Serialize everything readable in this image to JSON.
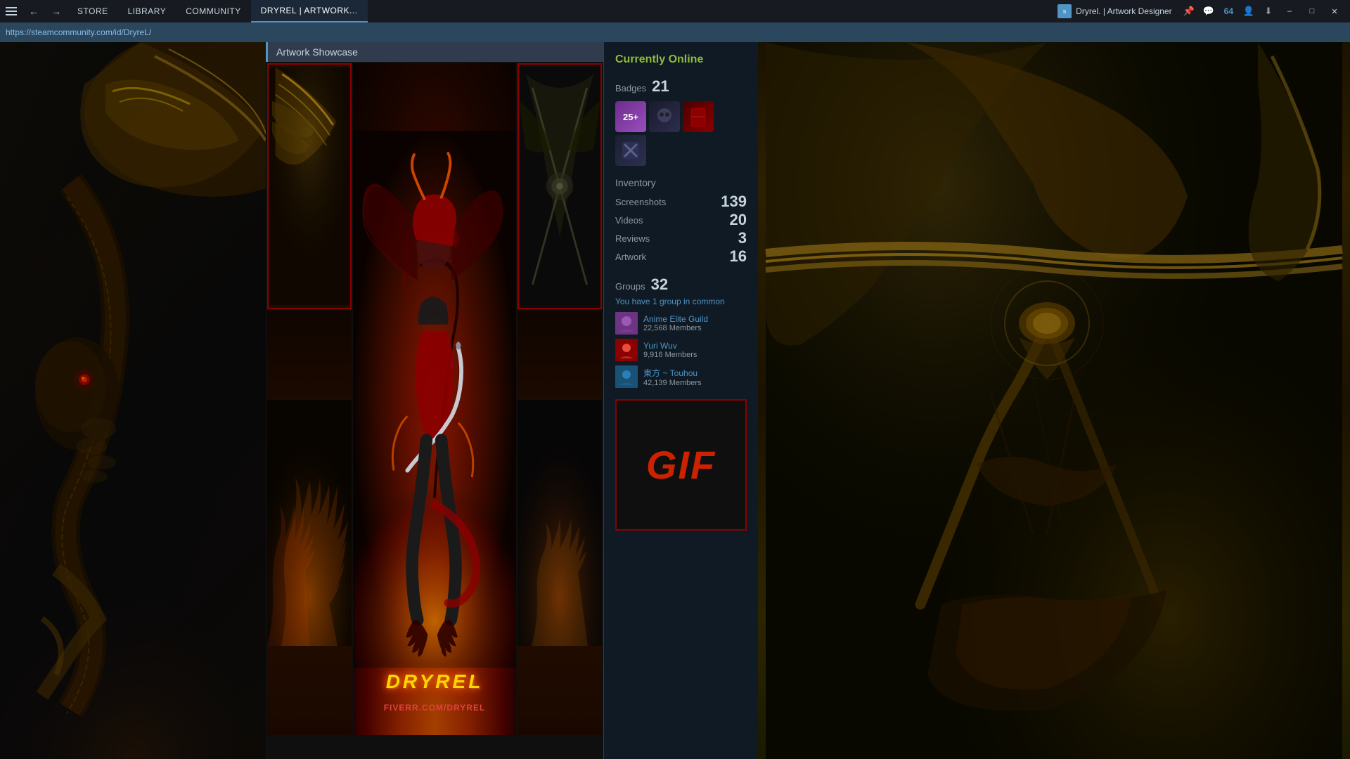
{
  "titlebar": {
    "nav_items": [
      "STORE",
      "LIBRARY",
      "COMMUNITY"
    ],
    "active_tab": "DRYREL | ARTWORK...",
    "app_title": "Dryrel. | Artwork Designer",
    "badge_count": "64",
    "address": "https://steamcommunity.com/id/DryreL/"
  },
  "profile": {
    "online_status": "Currently Online",
    "badges": {
      "label": "Badges",
      "count": "21",
      "items": [
        {
          "label": "25+",
          "type": "years"
        },
        {
          "label": "skull",
          "type": "icon"
        },
        {
          "label": "red",
          "type": "icon"
        },
        {
          "label": "crossed",
          "type": "icon"
        }
      ]
    },
    "inventory": {
      "label": "Inventory",
      "stats": [
        {
          "label": "Screenshots",
          "value": "139"
        },
        {
          "label": "Videos",
          "value": "20"
        },
        {
          "label": "Reviews",
          "value": "3"
        },
        {
          "label": "Artwork",
          "value": "16"
        }
      ]
    },
    "groups": {
      "label": "Groups",
      "count": "32",
      "common_text": "You have",
      "common_count": "1 group",
      "common_suffix": "in common",
      "items": [
        {
          "name": "Anime Elite Guild",
          "members": "22,568 Members",
          "type": "av1"
        },
        {
          "name": "Yuri Wuv",
          "members": "9,916 Members",
          "type": "av2"
        },
        {
          "name": "東方 ~ Touhou",
          "members": "42,139 Members",
          "type": "av3"
        }
      ]
    },
    "gif_label": "GIF"
  },
  "artwork": {
    "showcase_title": "Artwork Showcase",
    "dryrel_text": "DRYREL",
    "fiverr_text": "FIVERR.COM/DRYREL"
  }
}
